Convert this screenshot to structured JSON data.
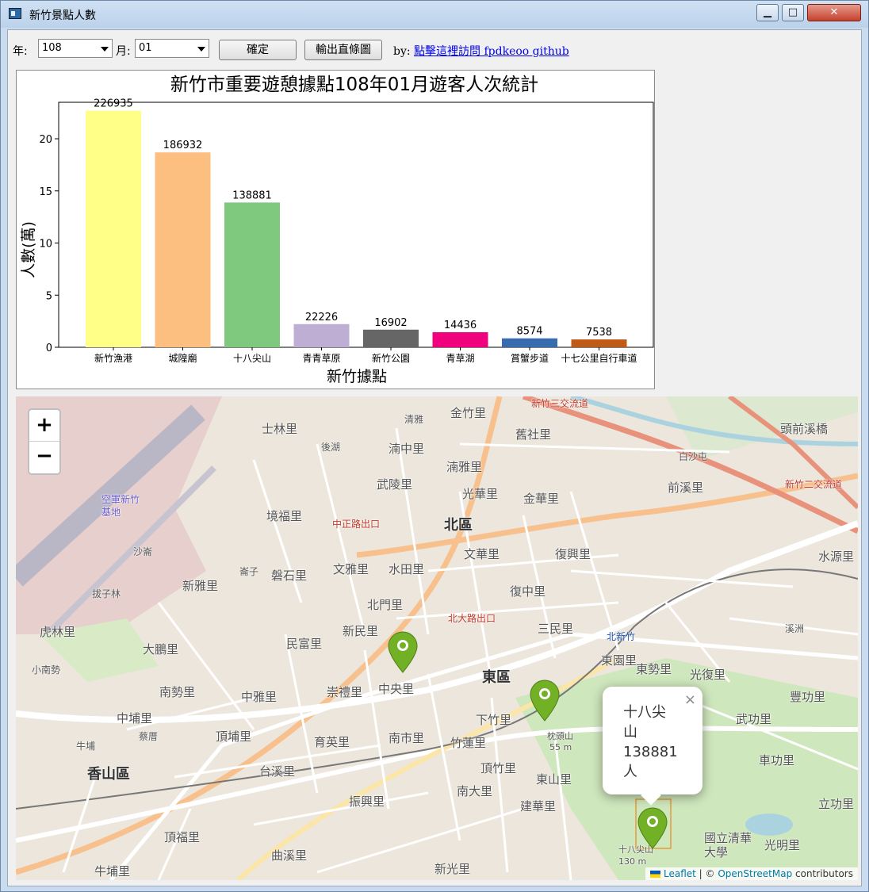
{
  "window": {
    "title": "新竹景點人數",
    "min_label": "▁",
    "max_label": "□",
    "close_label": "✕"
  },
  "toolbar": {
    "year_label": "年:",
    "year_value": "108",
    "month_label": "月:",
    "month_value": "01",
    "confirm_label": "確定",
    "export_label": "輸出直條圖",
    "by_label": "by:",
    "link_text": "點擊這裡訪問 fpdkeoo github"
  },
  "chart_data": {
    "type": "bar",
    "title": "新竹市重要遊憩據點108年01月遊客人次統計",
    "xlabel": "新竹據點",
    "ylabel": "人數(萬)",
    "categories": [
      "新竹漁港",
      "城隍廟",
      "十八尖山",
      "青青草原",
      "新竹公園",
      "青草湖",
      "賞蟹步道",
      "十七公里自行車道"
    ],
    "values": [
      226935,
      186932,
      138881,
      22226,
      16902,
      14436,
      8574,
      7538
    ],
    "ylim": [
      0,
      23.5
    ],
    "yticks": [
      0,
      5,
      10,
      15,
      20
    ],
    "colors": [
      "#ffff88",
      "#fdbf80",
      "#7fc97f",
      "#beaed4",
      "#666666",
      "#f0027f",
      "#386cb0",
      "#bf5b17"
    ],
    "grid": false,
    "legend": "none"
  },
  "map": {
    "zoom_in": "+",
    "zoom_out": "−",
    "labels": [
      {
        "t": "士林里"
      },
      {
        "t": "清雅"
      },
      {
        "t": "金竹里"
      },
      {
        "t": "舊社里"
      },
      {
        "t": "頭前溪橋"
      },
      {
        "t": "後湖"
      },
      {
        "t": "湳中里"
      },
      {
        "t": "湳雅里"
      },
      {
        "t": "白沙屯"
      },
      {
        "t": "空軍新竹基地"
      },
      {
        "t": "武陵里"
      },
      {
        "t": "光華里"
      },
      {
        "t": "金華里"
      },
      {
        "t": "前溪里"
      },
      {
        "t": "境福里"
      },
      {
        "t": "中正路出口"
      },
      {
        "t": "北區"
      },
      {
        "t": "沙崙"
      },
      {
        "t": "文華里"
      },
      {
        "t": "復興里"
      },
      {
        "t": "水源里"
      },
      {
        "t": "新雅里"
      },
      {
        "t": "崙子"
      },
      {
        "t": "磐石里"
      },
      {
        "t": "文雅里"
      },
      {
        "t": "水田里"
      },
      {
        "t": "拔子林"
      },
      {
        "t": "復中里"
      },
      {
        "t": "北門里"
      },
      {
        "t": "北大路出口"
      },
      {
        "t": "三民里"
      },
      {
        "t": "北新竹"
      },
      {
        "t": "溪洲"
      },
      {
        "t": "虎林里"
      },
      {
        "t": "新民里"
      },
      {
        "t": "民富里"
      },
      {
        "t": "大鵬里"
      },
      {
        "t": "東區"
      },
      {
        "t": "東園里"
      },
      {
        "t": "東勢里"
      },
      {
        "t": "光復里"
      },
      {
        "t": "小南勢"
      },
      {
        "t": "南勢里"
      },
      {
        "t": "崇禮里"
      },
      {
        "t": "中央里"
      },
      {
        "t": "中雅里"
      },
      {
        "t": "豐功里"
      },
      {
        "t": "中埔里"
      },
      {
        "t": "蔡厝"
      },
      {
        "t": "頂埔里"
      },
      {
        "t": "育英里"
      },
      {
        "t": "南市里"
      },
      {
        "t": "下竹里"
      },
      {
        "t": "竹蓮里"
      },
      {
        "t": "枕頭山"
      },
      {
        "t": "55 m"
      },
      {
        "t": "武功里"
      },
      {
        "t": "香山區"
      },
      {
        "t": "台溪里"
      },
      {
        "t": "頂竹里"
      },
      {
        "t": "東山里"
      },
      {
        "t": "車功里"
      },
      {
        "t": "振興里"
      },
      {
        "t": "南大里"
      },
      {
        "t": "建華里"
      },
      {
        "t": "立功里"
      },
      {
        "t": "頂福里"
      },
      {
        "t": "曲溪里"
      },
      {
        "t": "國立清華大學"
      },
      {
        "t": "光明里"
      },
      {
        "t": "牛埔里"
      },
      {
        "t": "新光里"
      },
      {
        "t": "十八尖山"
      },
      {
        "t": "130 m"
      },
      {
        "t": "新竹三交流道"
      },
      {
        "t": "新竹二交流道"
      },
      {
        "t": "牛埔"
      }
    ],
    "popup": {
      "line1": "十八尖",
      "line2": "山",
      "line3": "138881",
      "line4": "人",
      "close": "×"
    },
    "attribution": {
      "leaflet": "Leaflet",
      "sep": " | © ",
      "osm": "OpenStreetMap",
      "tail": " contributors"
    }
  }
}
